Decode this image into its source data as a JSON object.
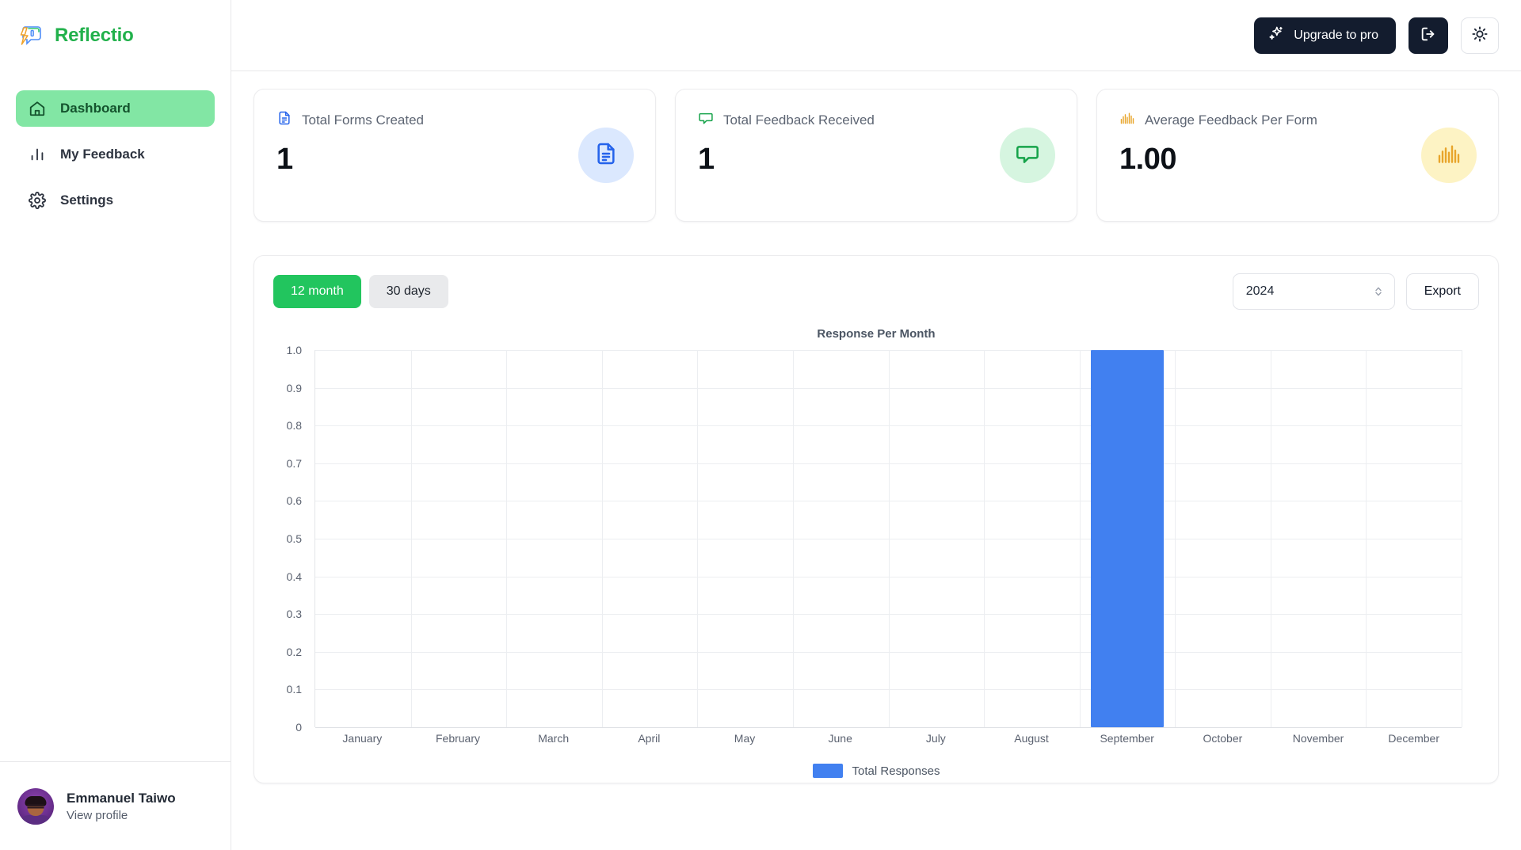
{
  "brand": {
    "name": "Reflectio",
    "logo_icon": "speech-bubble-bolt-icon"
  },
  "sidebar": {
    "items": [
      {
        "label": "Dashboard",
        "icon": "home-icon",
        "active": true
      },
      {
        "label": "My Feedback",
        "icon": "bar-chart-icon",
        "active": false
      },
      {
        "label": "Settings",
        "icon": "gear-icon",
        "active": false
      }
    ],
    "profile": {
      "name": "Emmanuel Taiwo",
      "link": "View profile",
      "avatar_icon": "user-avatar"
    }
  },
  "topbar": {
    "upgrade_label": "Upgrade to pro",
    "upgrade_icon": "sparkles-icon",
    "logout_icon": "logout-icon",
    "theme_icon": "sun-icon"
  },
  "cards": [
    {
      "label": "Total Forms Created",
      "value": "1",
      "icon": "document-icon",
      "badge": "badge-blue",
      "accent": "#2563eb"
    },
    {
      "label": "Total Feedback Received",
      "value": "1",
      "icon": "chat-bubble-icon",
      "badge": "badge-green",
      "accent": "#16a34a"
    },
    {
      "label": "Average Feedback Per Form",
      "value": "1.00",
      "icon": "bar-chart-icon",
      "badge": "badge-amber",
      "accent": "#e8a52b"
    }
  ],
  "chart_panel": {
    "range_buttons": [
      {
        "label": "12 month",
        "active": true
      },
      {
        "label": "30 days",
        "active": false
      }
    ],
    "year_value": "2024",
    "year_options": [
      "2024"
    ],
    "export_label": "Export",
    "select_icon": "chevron-updown-icon"
  },
  "chart_data": {
    "type": "bar",
    "title": "Response Per Month",
    "xlabel": "",
    "ylabel": "",
    "ylim": [
      0,
      1.0
    ],
    "yticks": [
      "1.0",
      "0.9",
      "0.8",
      "0.7",
      "0.6",
      "0.5",
      "0.4",
      "0.3",
      "0.2",
      "0.1",
      "0"
    ],
    "grid": true,
    "legend_position": "bottom",
    "categories": [
      "January",
      "February",
      "March",
      "April",
      "May",
      "June",
      "July",
      "August",
      "September",
      "October",
      "November",
      "December"
    ],
    "series": [
      {
        "name": "Total Responses",
        "color": "#4180f0",
        "values": [
          0,
          0,
          0,
          0,
          0,
          0,
          0,
          0,
          1,
          0,
          0,
          0
        ]
      }
    ]
  },
  "colors": {
    "brand_green": "#22b14c",
    "active_nav": "#82e6a4",
    "accent_green": "#22c55e",
    "bar_blue": "#4180f0",
    "dark_button": "#131c2e"
  }
}
